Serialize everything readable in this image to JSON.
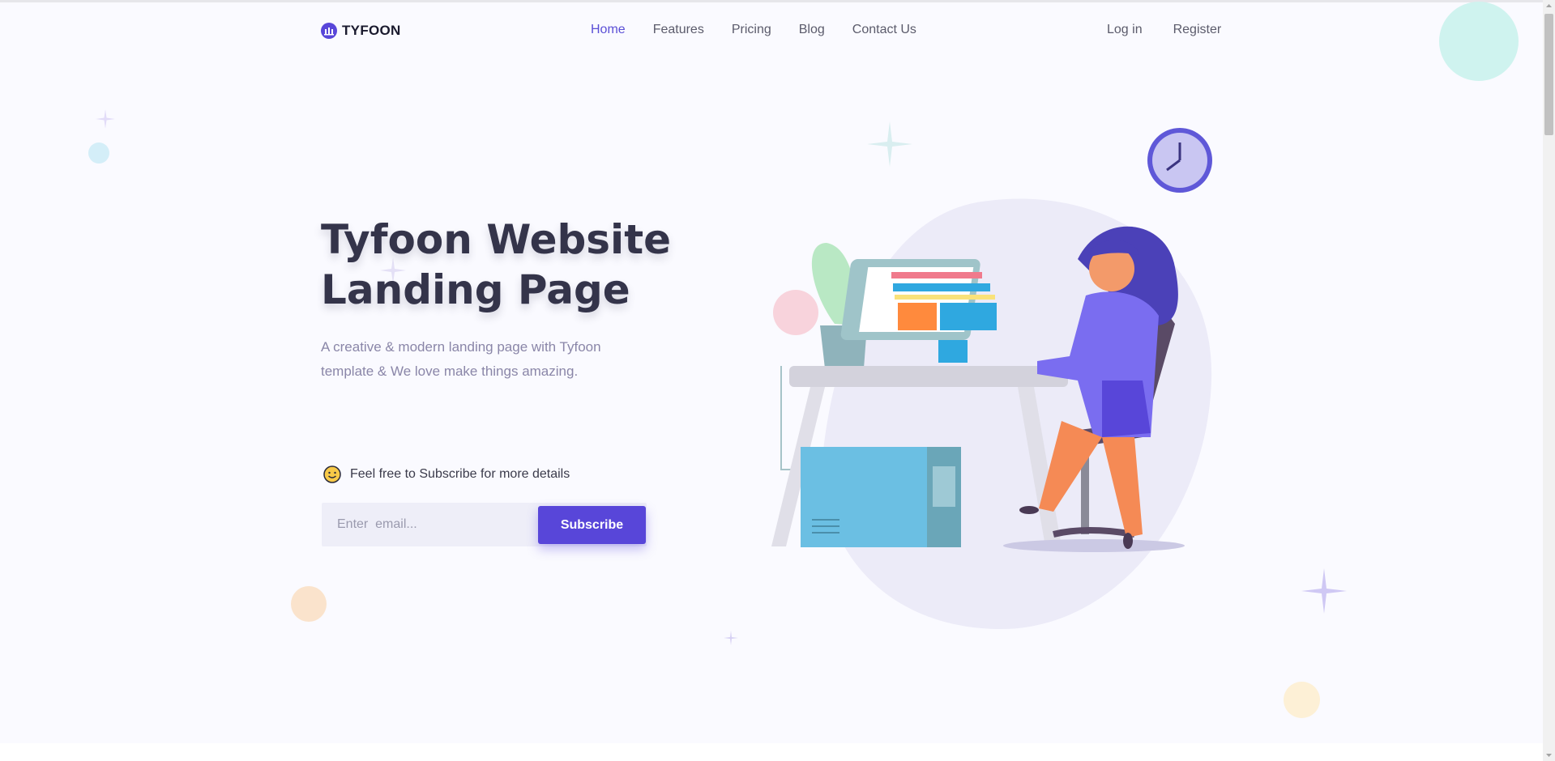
{
  "brand": {
    "name": "TYFOON",
    "icon": "building-logo-icon",
    "accent": "#5846d9"
  },
  "nav": {
    "items": [
      {
        "label": "Home",
        "active": true
      },
      {
        "label": "Features",
        "active": false
      },
      {
        "label": "Pricing",
        "active": false
      },
      {
        "label": "Blog",
        "active": false
      },
      {
        "label": "Contact Us",
        "active": false
      }
    ]
  },
  "auth": {
    "login": "Log in",
    "register": "Register"
  },
  "hero": {
    "title_line1": "Tyfoon Website",
    "title_line2": "Landing Page",
    "subtitle_line1": "A creative & modern landing page with Tyfoon",
    "subtitle_line2": "template & We love make things amazing."
  },
  "subscribe": {
    "note": "Feel free to Subscribe for more details",
    "note_icon": "emoji-smile-icon",
    "email_placeholder": "Enter  email...",
    "button_label": "Subscribe"
  },
  "illustration": {
    "description_icon": "woman-at-desk-illustration"
  }
}
